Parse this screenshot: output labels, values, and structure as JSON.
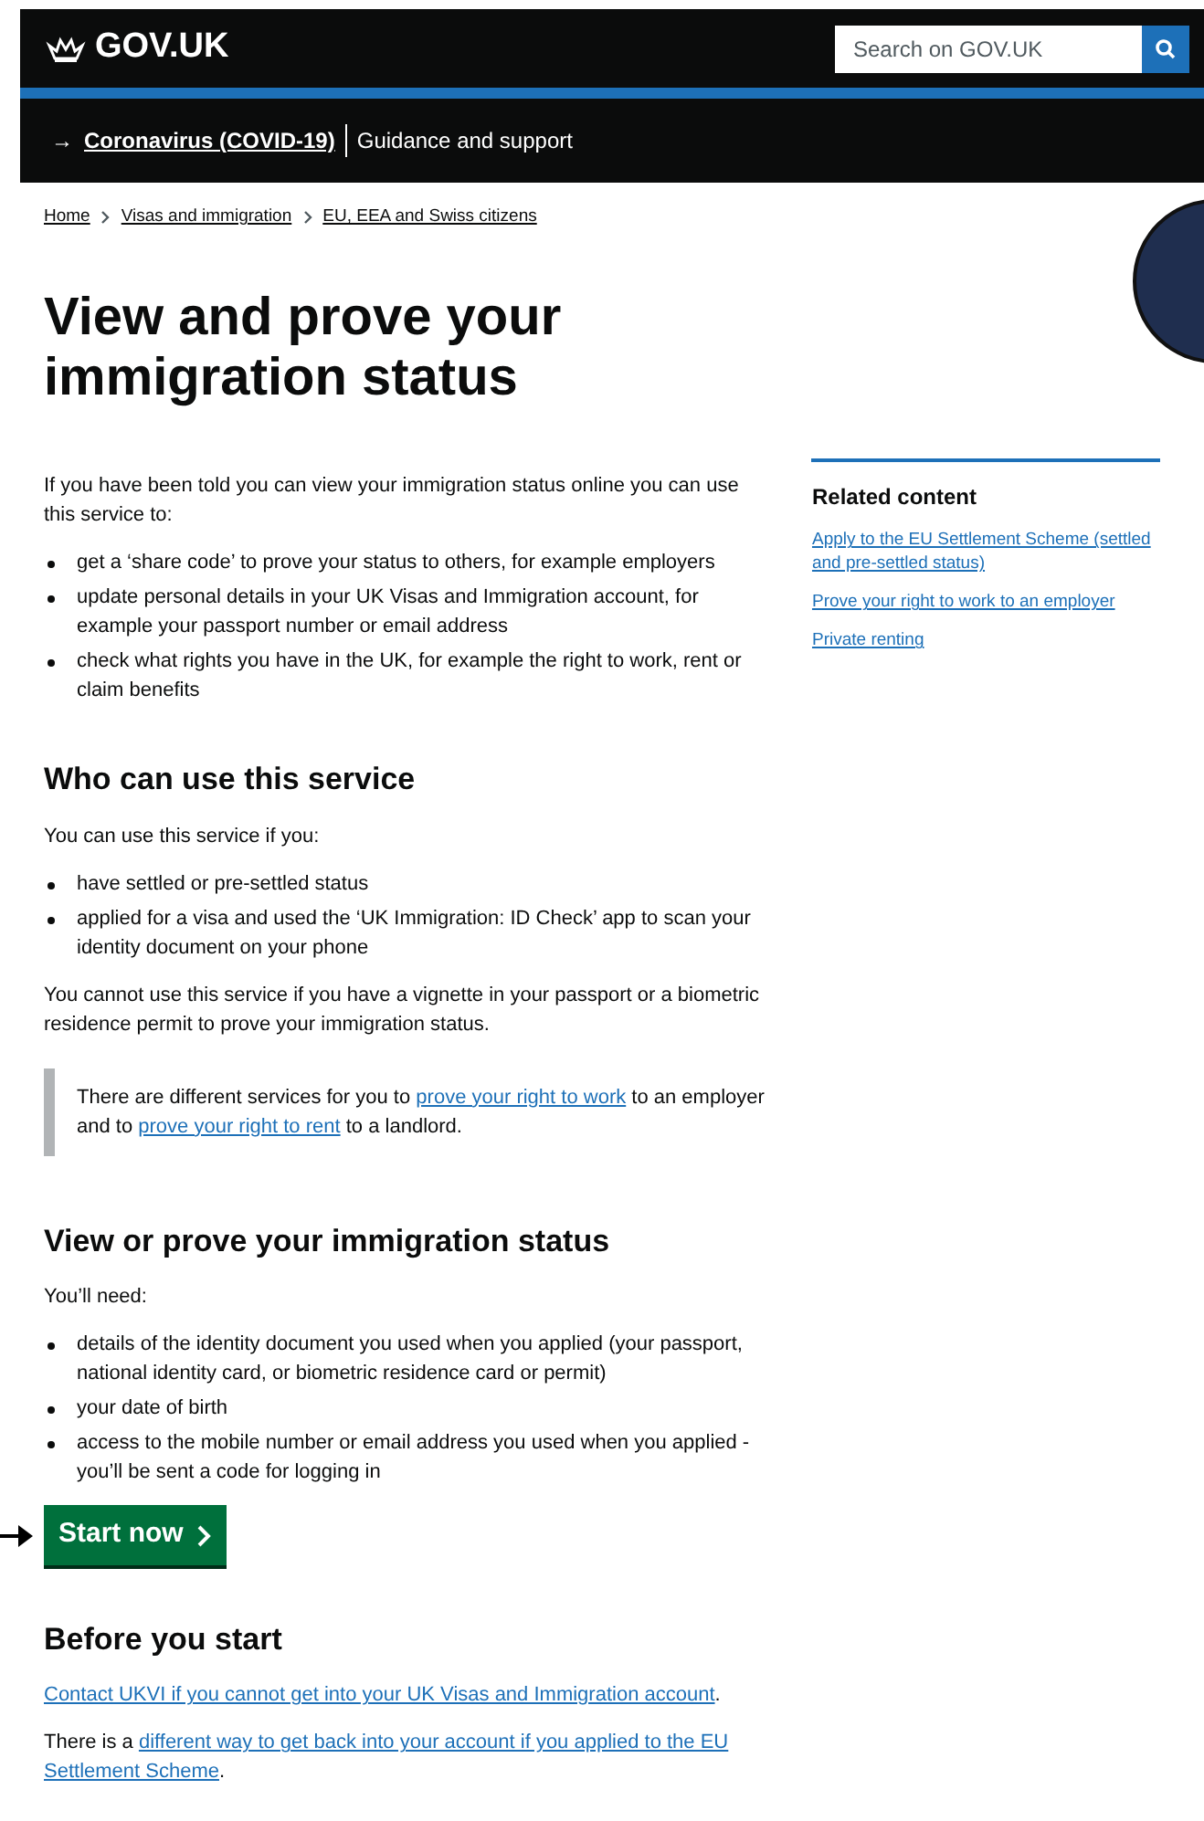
{
  "header": {
    "logo": "GOV.UK",
    "search": {
      "placeholder": "Search on GOV.UK"
    }
  },
  "banner": {
    "arrow": "→",
    "link": "Coronavirus (COVID-19)",
    "text": "Guidance and support"
  },
  "breadcrumbs": [
    "Home",
    "Visas and immigration",
    "EU, EEA and Swiss citizens"
  ],
  "title": "View and prove your immigration status",
  "intro": "If you have been told you can view your immigration status online you can use this service to:",
  "intro_list": [
    "get a ‘share code’ to prove your status to others, for example employers",
    "update personal details in your UK Visas and Immigration account, for example your passport number or email address",
    "check what rights you have in the UK, for example the right to work, rent or claim benefits"
  ],
  "sections": [
    {
      "heading": "Who can use this service",
      "blocks": [
        {
          "kind": "text",
          "parts": [
            {
              "kind": "text",
              "text": "You can use this service if you:"
            }
          ]
        },
        {
          "kind": "list",
          "items": [
            "have settled or pre-settled status",
            "applied for a visa and used the ‘UK Immigration: ID Check’ app to scan your identity document on your phone"
          ]
        },
        {
          "kind": "text",
          "parts": [
            {
              "kind": "text",
              "text": "You cannot use this service if you have a vignette in your passport or a biometric residence permit to prove your immigration status."
            }
          ]
        },
        {
          "kind": "inset",
          "parts": [
            {
              "kind": "text",
              "text": "There are different services for you to "
            },
            {
              "kind": "link",
              "text": "prove your right to work"
            },
            {
              "kind": "text",
              "text": " to an employer and to "
            },
            {
              "kind": "link",
              "text": "prove your right to rent"
            },
            {
              "kind": "text",
              "text": " to a landlord."
            }
          ]
        }
      ]
    },
    {
      "heading": "View or prove your immigration status",
      "blocks": [
        {
          "kind": "text",
          "parts": [
            {
              "kind": "text",
              "text": "You’ll need:"
            }
          ]
        },
        {
          "kind": "list",
          "items": [
            "details of the identity document you used when you applied (your passport, national identity card, or biometric residence card or permit)",
            "your date of birth",
            "access to the mobile number or email address you used when you applied - you’ll be sent a code for logging in"
          ]
        },
        {
          "kind": "start",
          "label": "Start now"
        }
      ]
    },
    {
      "heading": "Before you start",
      "blocks": [
        {
          "kind": "text",
          "parts": [
            {
              "kind": "link",
              "text": "Contact UKVI if you cannot get into your UK Visas and Immigration account"
            },
            {
              "kind": "text",
              "text": "."
            }
          ]
        },
        {
          "kind": "text",
          "parts": [
            {
              "kind": "text",
              "text": "There is a "
            },
            {
              "kind": "link",
              "text": "different way to get back into your account if you applied to the EU"
            },
            {
              "kind": "link",
              "text": "Settlement Scheme"
            },
            {
              "kind": "text",
              "text": "."
            }
          ]
        }
      ]
    }
  ],
  "related": {
    "heading": "Related content",
    "links": [
      "Apply to the EU Settlement Scheme (settled and pre-settled status)",
      "Prove your right to work to an employer",
      "Private renting"
    ]
  }
}
